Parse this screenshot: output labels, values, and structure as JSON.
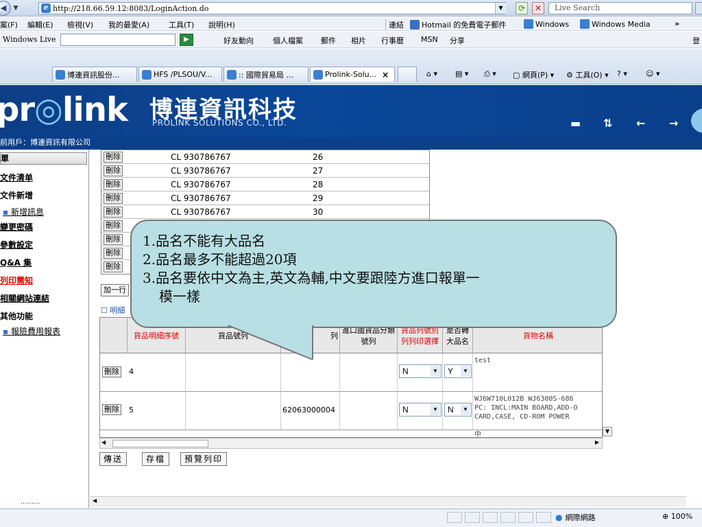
{
  "browser": {
    "url": "http://218.66.59.12:8083/LoginAction.do",
    "search_placeholder": "Live Search",
    "menu": [
      "案(F)",
      "編輯(E)",
      "檢視(V)",
      "我的最愛(A)",
      "工具(T)",
      "說明(H)"
    ],
    "links_label": "連結",
    "links": [
      "Hotmail 的免費電子郵件",
      "Windows",
      "Windows Media"
    ],
    "more": "»",
    "live_label": "Windows Live",
    "live_items": [
      "好友動向",
      "個人檔案",
      "郵件",
      "相片",
      "行事曆",
      "MSN",
      "分享"
    ],
    "live_right": "登",
    "tabs": [
      "博連資訊股份...",
      "HFS /PLSOU/V...",
      ":: 國際貿易局 ...",
      "Prolink-Solu..."
    ],
    "toolbar_page": "網頁(P)",
    "toolbar_tools": "工具(O)",
    "status_zone": "網際網路",
    "zoom": "100%"
  },
  "banner": {
    "logo": "prolink",
    "company_zh": "博連資訊科技",
    "company_en": "PROLINK SOLUTIONS CO., LTD.",
    "user_line": "前用戶：博連資訊有限公司"
  },
  "nav": {
    "header": "單",
    "items": [
      {
        "label": "文件清单",
        "style": "bold"
      },
      {
        "label": "文件新增",
        "style": "bold-plain"
      },
      {
        "label": "新增訊息",
        "style": "sub"
      },
      {
        "label": "變更密碼",
        "style": "bold"
      },
      {
        "label": "參數設定",
        "style": "bold"
      },
      {
        "label": "Q&A 集",
        "style": "bold"
      },
      {
        "label": "列印需知",
        "style": "red"
      },
      {
        "label": "相關網站連結",
        "style": "bold"
      },
      {
        "label": "其他功能",
        "style": "bold-plain"
      },
      {
        "label": "報險費用報表",
        "style": "sub"
      }
    ],
    "dots": "........."
  },
  "top_table": {
    "delete_label": "刪除",
    "rows": [
      {
        "code": "CL  930786767",
        "seq": "26"
      },
      {
        "code": "CL  930786767",
        "seq": "27"
      },
      {
        "code": "CL  930786767",
        "seq": "28"
      },
      {
        "code": "CL  930786767",
        "seq": "29"
      },
      {
        "code": "CL  930786767",
        "seq": "30"
      },
      {
        "code": "",
        "seq": ""
      },
      {
        "code": "",
        "seq": ""
      },
      {
        "code": "",
        "seq": ""
      },
      {
        "code": "",
        "seq": ""
      }
    ]
  },
  "add_row_label": "加一行",
  "detail_label": "☐ 明細",
  "detail": {
    "headers": [
      "貨品明細序號",
      "貨品號列",
      "列",
      "進口國貨品分類號列",
      "貨品列號別列列印選擇",
      "是否轉大品名",
      "貨物名稱"
    ],
    "rows": [
      {
        "seq": "4",
        "col2": "",
        "col3": "",
        "col4": "",
        "print": "N",
        "major": "Y",
        "name": "test"
      },
      {
        "seq": "5",
        "col2": "",
        "col3": "62063000004",
        "col4": "",
        "print": "N",
        "major": "N",
        "name": "WJ6W710L012B WJ6300S-686\nPC: INCL:MAIN BOARD,ADD-O\nCARD,CASE, CD-ROM POWER"
      }
    ],
    "partial_row": "中"
  },
  "actions": [
    "傳送",
    "存檔",
    "預覽列印"
  ],
  "callout": {
    "lines": [
      "1.品名不能有大品名",
      "2.品名最多不能超過20項",
      "3.品名要依中文為主,英文為輔,中文要跟陸方進口報單一",
      "模一樣"
    ]
  }
}
